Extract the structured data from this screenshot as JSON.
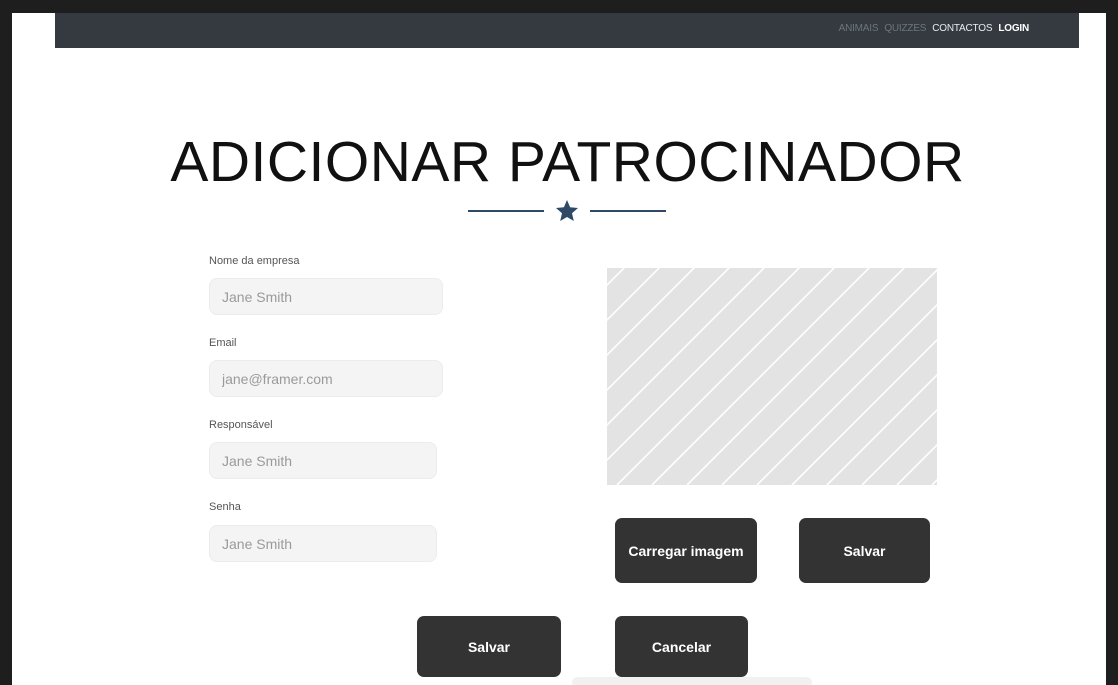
{
  "nav": {
    "items": [
      {
        "label": "ANIMAIS"
      },
      {
        "label": "QUIZZES"
      },
      {
        "label": "CONTACTOS"
      },
      {
        "label": "LOGIN"
      }
    ]
  },
  "page": {
    "title": "ADICIONAR PATROCINADOR"
  },
  "form": {
    "company": {
      "label": "Nome da empresa",
      "placeholder": "Jane Smith"
    },
    "email": {
      "label": "Email",
      "placeholder": "jane@framer.com"
    },
    "responsible": {
      "label": "Responsável",
      "placeholder": "Jane Smith"
    },
    "password": {
      "label": "Senha",
      "placeholder": "Jane Smith"
    }
  },
  "image": {
    "upload_label": "Carregar imagem",
    "save_label": "Salvar"
  },
  "actions": {
    "save_label": "Salvar",
    "cancel_label": "Cancelar"
  },
  "colors": {
    "navbar": "#343a40",
    "accent": "#2e4a66",
    "button": "#333333"
  }
}
